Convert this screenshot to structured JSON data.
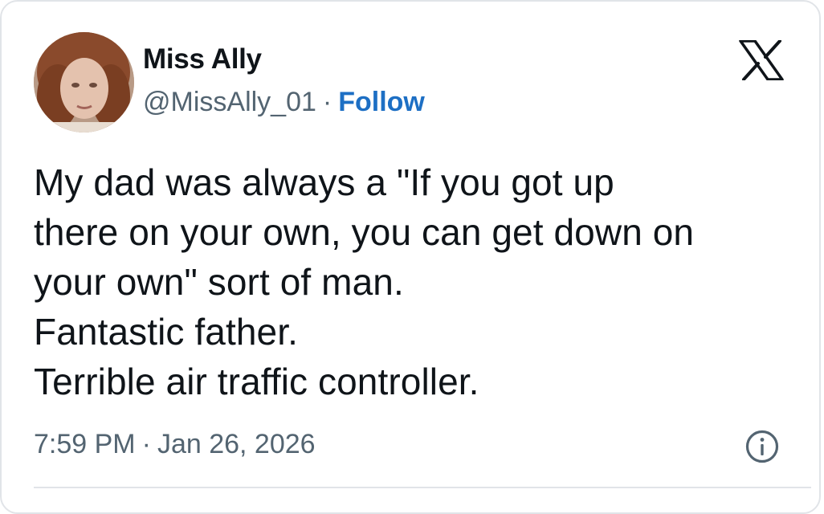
{
  "author": {
    "display_name": "Miss Ally",
    "handle": "@MissAlly_01",
    "separator": "·",
    "follow_label": "Follow"
  },
  "tweet": {
    "lines": [
      "My dad was always a \"If you got up",
      "there on your own, you can get down on",
      "your own\" sort of man.",
      "Fantastic father.",
      "Terrible air traffic controller."
    ]
  },
  "meta": {
    "time": "7:59 PM",
    "separator": "·",
    "date": "Jan 26, 2026"
  },
  "icons": {
    "platform_logo": "x-logo-icon",
    "info": "info-icon"
  },
  "colors": {
    "text": "#0f1419",
    "secondary": "#536471",
    "link": "#1d6fc4",
    "border": "#e1e4e8"
  }
}
